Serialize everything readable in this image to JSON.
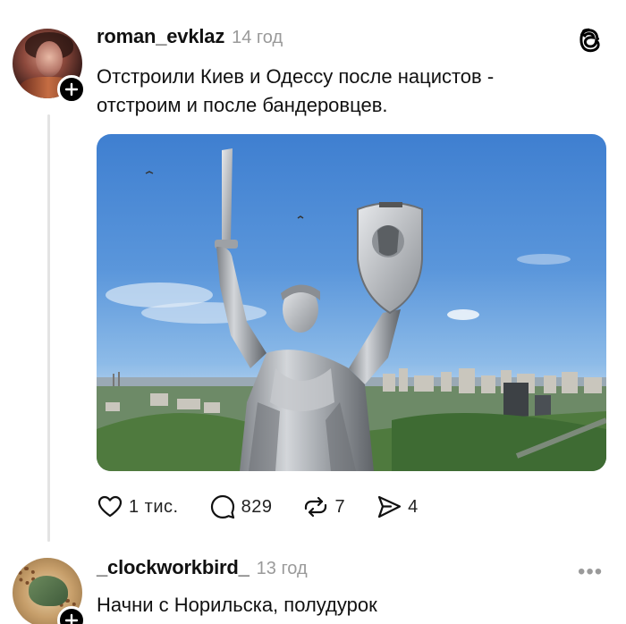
{
  "post": {
    "username": "roman_evklaz",
    "time": "14 год",
    "text_line1": "Отстроили Киев и Одессу после нацистов -",
    "text_line2": "отстроим и после бандеровцев.",
    "image_icon": "statue-photo",
    "actions": {
      "likes": "1 тис.",
      "comments": "829",
      "reposts": "7",
      "shares": "4"
    }
  },
  "reply": {
    "username": "_clockworkbird_",
    "time": "13 год",
    "text": "Начни с Норильска, полудурок",
    "more_label": "•••"
  },
  "colors": {
    "accent": "#000000",
    "muted": "#9a9a9a",
    "thread_line": "#e3e3e3"
  },
  "icons": [
    "plus-icon",
    "threads-logo-icon",
    "heart-icon",
    "comment-icon",
    "repost-icon",
    "share-icon",
    "more-icon"
  ]
}
